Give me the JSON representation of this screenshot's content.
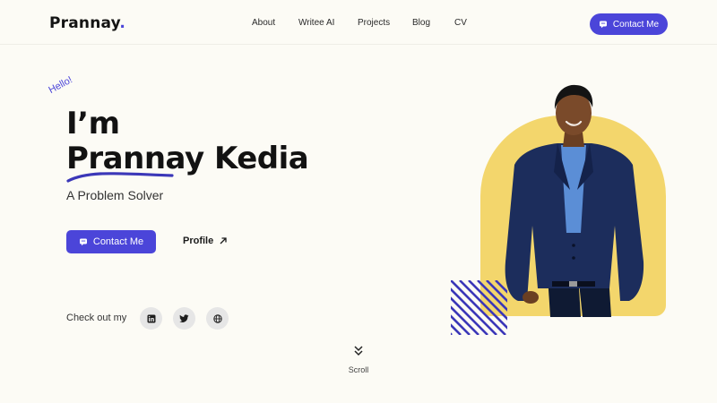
{
  "brand": {
    "name": "Prannay",
    "dot": "."
  },
  "nav": {
    "links": [
      "About",
      "Writee AI",
      "Projects",
      "Blog",
      "CV"
    ],
    "cta_label": "Contact Me"
  },
  "hero": {
    "greeting": "Hello!",
    "line1": "I’m",
    "first_name": "Prannay",
    "last_name": "Kedia",
    "tagline": "A Problem Solver",
    "cta_label": "Contact Me",
    "profile_label": "Profile"
  },
  "social": {
    "label": "Check out my",
    "items": [
      {
        "name": "linkedin-icon"
      },
      {
        "name": "twitter-icon"
      },
      {
        "name": "globe-icon"
      }
    ]
  },
  "scroll": {
    "label": "Scroll"
  },
  "colors": {
    "accent": "#4b45d9",
    "photo_bg": "#f3d66c",
    "page_bg": "#fcfbf5"
  }
}
